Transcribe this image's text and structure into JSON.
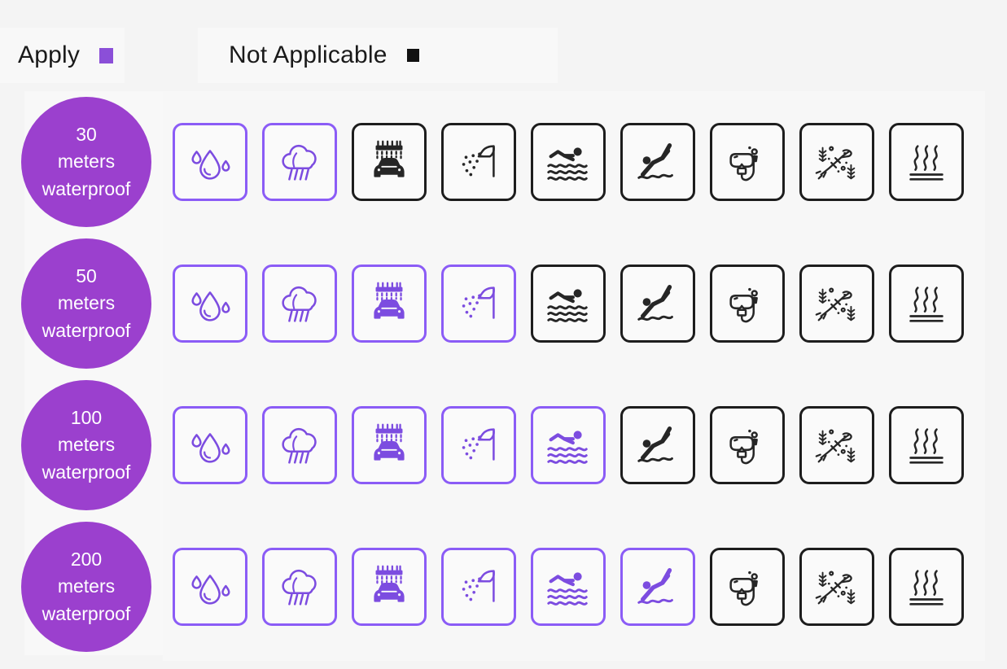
{
  "legend": {
    "apply": {
      "label": "Apply",
      "swatch_color": "#8b4fd8",
      "swatch_name": "purple-square"
    },
    "not_applicable": {
      "label": "Not Applicable",
      "swatch_color": "#111111",
      "swatch_name": "black-square"
    }
  },
  "colors": {
    "circle_fill": "#9b40ce",
    "apply_border": "#8b5cf6",
    "apply_icon": "#7c4ce0",
    "na_border": "#1d1d1d",
    "na_icon": "#262626",
    "page_background": "#f4f4f4",
    "panel_background": "#f8f8f8"
  },
  "columns": [
    {
      "key": "water-drops",
      "icon": "water-drops-icon",
      "label": "Water drops / splashes"
    },
    {
      "key": "rain",
      "icon": "rain-cloud-icon",
      "label": "Rain"
    },
    {
      "key": "car-wash",
      "icon": "car-wash-icon",
      "label": "Car wash"
    },
    {
      "key": "shower",
      "icon": "shower-icon",
      "label": "Shower"
    },
    {
      "key": "swimming",
      "icon": "swimming-icon",
      "label": "Swimming"
    },
    {
      "key": "diving",
      "icon": "springboard-diving-icon",
      "label": "Diving"
    },
    {
      "key": "snorkeling",
      "icon": "snorkel-mask-icon",
      "label": "Snorkeling"
    },
    {
      "key": "scuba",
      "icon": "scuba-diving-icon",
      "label": "Scuba diving"
    },
    {
      "key": "hot-water",
      "icon": "steam-heat-icon",
      "label": "Hot water / sauna"
    }
  ],
  "rows": [
    {
      "depth": "30",
      "unit": "meters",
      "qualifier": "waterproof",
      "states": [
        "apply",
        "apply",
        "na",
        "na",
        "na",
        "na",
        "na",
        "na",
        "na"
      ]
    },
    {
      "depth": "50",
      "unit": "meters",
      "qualifier": "waterproof",
      "states": [
        "apply",
        "apply",
        "apply",
        "apply",
        "na",
        "na",
        "na",
        "na",
        "na"
      ]
    },
    {
      "depth": "100",
      "unit": "meters",
      "qualifier": "waterproof",
      "states": [
        "apply",
        "apply",
        "apply",
        "apply",
        "apply",
        "na",
        "na",
        "na",
        "na"
      ]
    },
    {
      "depth": "200",
      "unit": "meters",
      "qualifier": "waterproof",
      "states": [
        "apply",
        "apply",
        "apply",
        "apply",
        "apply",
        "apply",
        "na",
        "na",
        "na"
      ]
    }
  ]
}
